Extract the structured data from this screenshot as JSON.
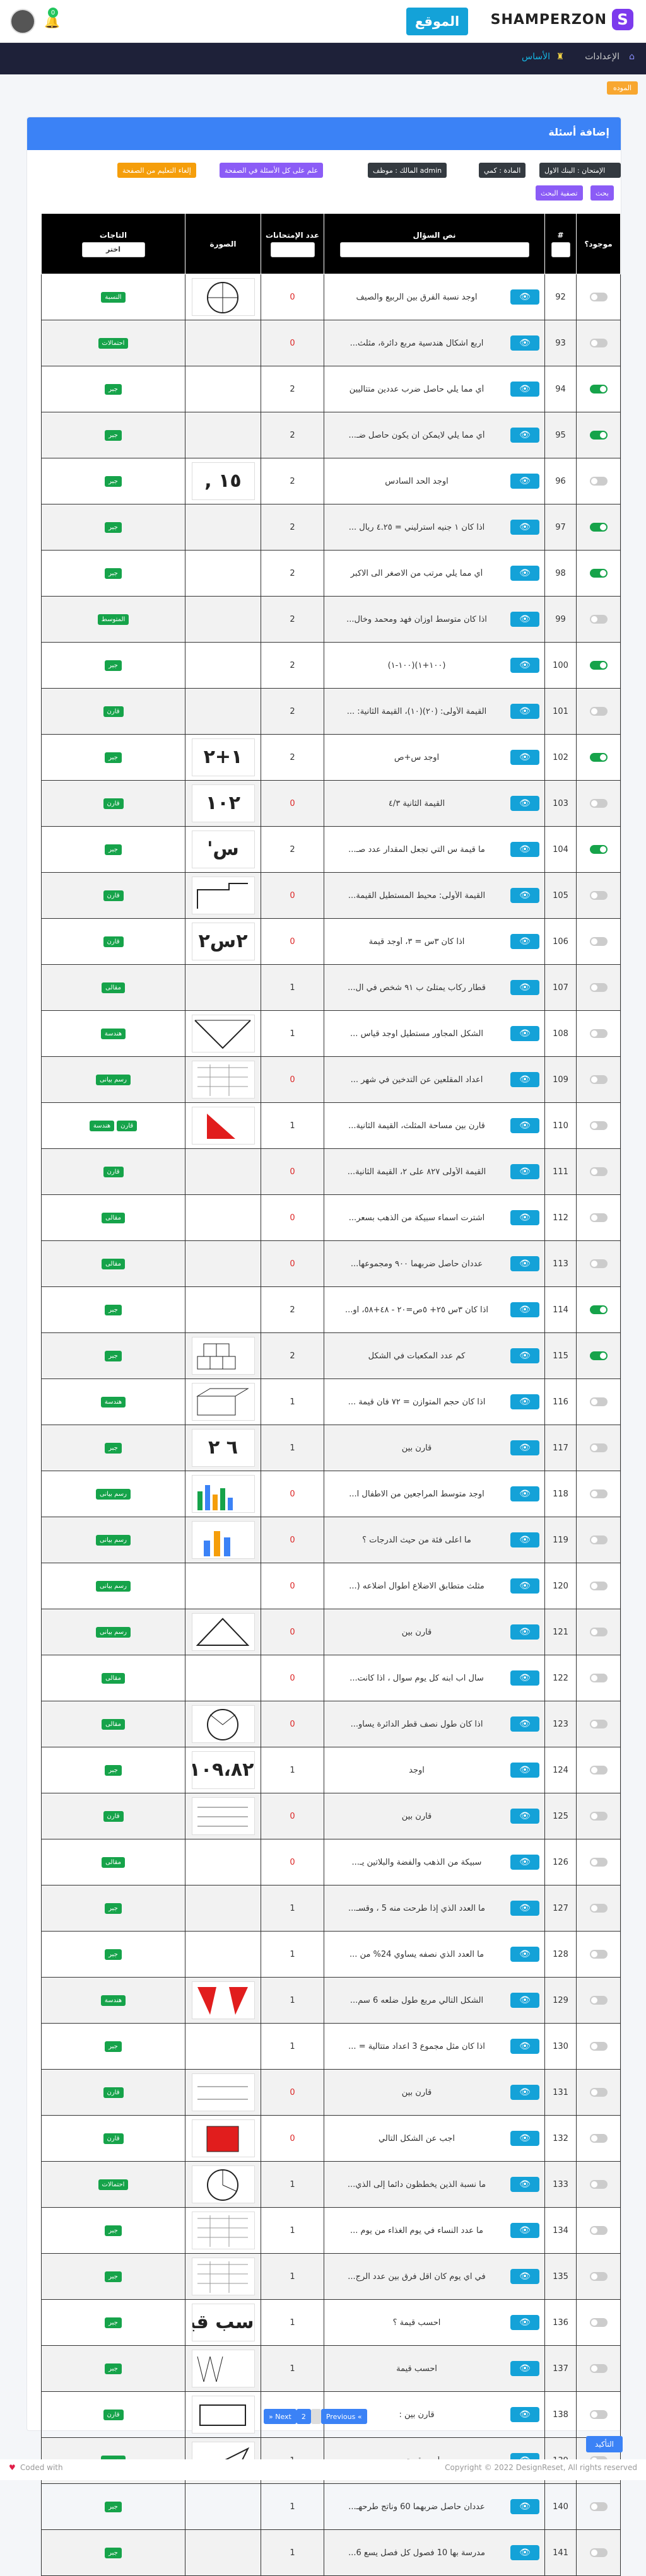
{
  "header": {
    "brand": "SHAMPERZON",
    "brand_mark": "S",
    "site_button": "الموقع",
    "notif_count": "0"
  },
  "nav": {
    "settings": "الإعدادات",
    "basics": "الأساس"
  },
  "breadcrumb": "الموده",
  "card": {
    "title": "إضافة أسئلة"
  },
  "filters": {
    "exam": "الإمتحان : البنك الاول",
    "subject": "المادة : كمي",
    "owner": "المالك : موظف admin",
    "search": "بحث",
    "reset": "تصفية البحث",
    "mark_all": "علم على كل الأسئلة في الصفحة",
    "unmark_all": "إلغاء التعليم من الصفحة"
  },
  "table": {
    "headers": {
      "exists": "موجود؟",
      "num": "#",
      "text": "نص السؤال",
      "exams": "عدد الإمتحانات",
      "image": "الصورة",
      "tags": "التاجات"
    },
    "tag_select": "اختر",
    "rows": [
      {
        "n": "92",
        "q": "اوجد نسبة الفرق بين الربيع والصيف",
        "c": "0",
        "img": "circle",
        "tags": [
          "النسبة"
        ],
        "on": false
      },
      {
        "n": "93",
        "q": "اربع اشكال هندسية مربع دائرة، مثلث...",
        "c": "0",
        "img": "",
        "tags": [
          "احتمالات"
        ],
        "on": false
      },
      {
        "n": "94",
        "q": "أي مما يلي حاصل ضرب عددين متتاليين",
        "c": "2",
        "img": "",
        "tags": [
          "جبر"
        ],
        "on": true
      },
      {
        "n": "95",
        "q": "أي مما يلي لايمكن ان يكون حاصل ضـ...",
        "c": "2",
        "img": "",
        "tags": [
          "جبر"
        ],
        "on": true
      },
      {
        "n": "96",
        "q": "اوجد الحد السادس",
        "c": "2",
        "img": "١٥ ,",
        "tags": [
          "جبر"
        ],
        "on": false
      },
      {
        "n": "97",
        "q": "اذا كان ١ جنيه استرليني = ٤.٢٥ ريال ...",
        "c": "2",
        "img": "",
        "tags": [
          "جبر"
        ],
        "on": true
      },
      {
        "n": "98",
        "q": "أي مما يلي مرتب من الاصغر الى الاكبر",
        "c": "2",
        "img": "",
        "tags": [
          "جبر"
        ],
        "on": true
      },
      {
        "n": "99",
        "q": "اذا كان متوسط اوزان فهد ومحمد وخال...",
        "c": "2",
        "img": "",
        "tags": [
          "المتوسط"
        ],
        "on": false
      },
      {
        "n": "100",
        "q": "(١٠٠+١)(١٠٠-١)",
        "c": "2",
        "img": "",
        "tags": [
          "جبر"
        ],
        "on": true
      },
      {
        "n": "101",
        "q": "القيمة الأولى: (٢٠)(١٠)، القيمة الثانية: ...",
        "c": "2",
        "img": "",
        "tags": [
          "قارن"
        ],
        "on": false
      },
      {
        "n": "102",
        "q": "اوجد س+ص",
        "c": "2",
        "img": "١+٢",
        "tags": [
          "جبر"
        ],
        "on": true
      },
      {
        "n": "103",
        "q": "القيمة الثانية ٤/٣",
        "c": "0",
        "img": "١٠٢",
        "tags": [
          "قارن"
        ],
        "on": false
      },
      {
        "n": "104",
        "q": "ما قيمة س التي تجعل المقدار عدد صـ...",
        "c": "2",
        "img": "س'",
        "tags": [
          "جبر"
        ],
        "on": true
      },
      {
        "n": "105",
        "q": "القيمة الأولى: محيط المستطيل القيمة...",
        "c": "0",
        "img": "line",
        "tags": [
          "قارن"
        ],
        "on": false
      },
      {
        "n": "106",
        "q": "اذا كان ٣س = ٣، أوجد قيمة",
        "c": "0",
        "img": "٢س٢",
        "tags": [
          "قارن"
        ],
        "on": false
      },
      {
        "n": "107",
        "q": "قطار ركاب يمتلئ ب ٩١ شخص في ال...",
        "c": "1",
        "img": "",
        "tags": [
          "مقالى"
        ],
        "on": false
      },
      {
        "n": "108",
        "q": "الشكل المجاور مستطيل اوجد قياس ...",
        "c": "1",
        "img": "tri",
        "tags": [
          "هندسة"
        ],
        "on": false
      },
      {
        "n": "109",
        "q": "اعداد المقلعين عن التدخين في شهر ...",
        "c": "0",
        "img": "grid",
        "tags": [
          "رسم بيانى"
        ],
        "on": false
      },
      {
        "n": "110",
        "q": "قارن بين مساحة المثلث، القيمة الثانية...",
        "c": "1",
        "img": "redtri",
        "tags": [
          "قارن",
          "هندسة"
        ],
        "on": false
      },
      {
        "n": "111",
        "q": "القيمة الأولى ٨٢٧ على ٢، القيمة الثانية...",
        "c": "0",
        "img": "",
        "tags": [
          "قارن"
        ],
        "on": false
      },
      {
        "n": "112",
        "q": "اشترت اسماء سبيكة من الذهب بسعر...",
        "c": "0",
        "img": "",
        "tags": [
          "مقالى"
        ],
        "on": false
      },
      {
        "n": "113",
        "q": "عددان حاصل ضربهما ٩٠٠ ومجموعها...",
        "c": "0",
        "img": "",
        "tags": [
          "مقالى"
        ],
        "on": false
      },
      {
        "n": "114",
        "q": "اذا كان ٣س ٢٥+ ٥ص=٢٠ - ٤٨+٥٨، او...",
        "c": "2",
        "img": "",
        "tags": [
          "جبر"
        ],
        "on": true
      },
      {
        "n": "115",
        "q": "كم عدد المكعبات في الشكل",
        "c": "2",
        "img": "cube",
        "tags": [
          "جبر"
        ],
        "on": true
      },
      {
        "n": "116",
        "q": "اذا كان حجم المتوازن = ٧٢ فان قيمة ...",
        "c": "1",
        "img": "box",
        "tags": [
          "هندسة"
        ],
        "on": false
      },
      {
        "n": "117",
        "q": "قارن بين",
        "c": "1",
        "img": "٦ ٢",
        "tags": [
          "جبر"
        ],
        "on": false
      },
      {
        "n": "118",
        "q": "اوجد متوسط المراجعين من الاطفال ا...",
        "c": "0",
        "img": "bars",
        "tags": [
          "رسم بيانى"
        ],
        "on": false
      },
      {
        "n": "119",
        "q": "ما اعلى فئة من حيث الدرجات ؟",
        "c": "0",
        "img": "bars2",
        "tags": [
          "رسم بيانى"
        ],
        "on": false
      },
      {
        "n": "120",
        "q": "مثلث متطابق الاضلاع أطوال أضلاعه (...",
        "c": "0",
        "img": "",
        "tags": [
          "رسم بيانى"
        ],
        "on": false
      },
      {
        "n": "121",
        "q": "قارن بين",
        "c": "0",
        "img": "tri2",
        "tags": [
          "رسم بيانى"
        ],
        "on": false
      },
      {
        "n": "122",
        "q": "سال اب ابنه كل يوم سوال ، اذا كانت...",
        "c": "0",
        "img": "",
        "tags": [
          "مقالى"
        ],
        "on": false
      },
      {
        "n": "123",
        "q": "اذا كان طول نصف قطر الدائرة يساو...",
        "c": "0",
        "img": "circle2",
        "tags": [
          "مقالى"
        ],
        "on": false
      },
      {
        "n": "124",
        "q": "اوجد",
        "c": "1",
        "img": "١٠٩،٨٢ فرا",
        "tags": [
          "جبر"
        ],
        "on": false
      },
      {
        "n": "125",
        "q": "قارن بين",
        "c": "0",
        "img": "text",
        "tags": [
          "قارن"
        ],
        "on": false
      },
      {
        "n": "126",
        "q": "سبيكة من الذهب والفضة والبلاتين يـ...",
        "c": "0",
        "img": "",
        "tags": [
          "مقالى"
        ],
        "on": false
      },
      {
        "n": "127",
        "q": "ما العدد الذي إذا طرحت منه 5 ، وقسـ...",
        "c": "1",
        "img": "",
        "tags": [
          "جبر"
        ],
        "on": false
      },
      {
        "n": "128",
        "q": "ما العدد الذي نصفه يساوي 24% من ...",
        "c": "1",
        "img": "",
        "tags": [
          "جبر"
        ],
        "on": false
      },
      {
        "n": "129",
        "q": "الشكل التالي مربع طول ضلعه 6 سم...",
        "c": "1",
        "img": "redflag",
        "tags": [
          "هندسة"
        ],
        "on": false
      },
      {
        "n": "130",
        "q": "اذا كان مثل مجموع 3 اعداد متتالية = ...",
        "c": "1",
        "img": "",
        "tags": [
          "جبر"
        ],
        "on": false
      },
      {
        "n": "131",
        "q": "قارن بين",
        "c": "0",
        "img": "text2",
        "tags": [
          "قارن"
        ],
        "on": false
      },
      {
        "n": "132",
        "q": "اجب عن الشكل التالي",
        "c": "0",
        "img": "redsq",
        "tags": [
          "قارن"
        ],
        "on": false
      },
      {
        "n": "133",
        "q": "ما نسبة الذين يخطظون دائما إلى الذي...",
        "c": "1",
        "img": "pie",
        "tags": [
          "احتمالات"
        ],
        "on": false
      },
      {
        "n": "134",
        "q": "ما عدد النساء في يوم الغذاء من يوم ...",
        "c": "1",
        "img": "grid",
        "tags": [
          "جبر"
        ],
        "on": false
      },
      {
        "n": "135",
        "q": "في اي يوم كان اقل فرق بين عدد الرج...",
        "c": "1",
        "img": "grid",
        "tags": [
          "جبر"
        ],
        "on": false
      },
      {
        "n": "136",
        "q": "احسب قيمة ؟",
        "c": "1",
        "img": "سب قيمة",
        "tags": [
          "جبر"
        ],
        "on": false
      },
      {
        "n": "137",
        "q": "احسب قيمة",
        "c": "1",
        "img": "bars3",
        "tags": [
          "جبر"
        ],
        "on": false
      },
      {
        "n": "138",
        "q": "قارن بين :",
        "c": "0",
        "img": "line2",
        "tags": [
          "قارن"
        ],
        "on": false
      },
      {
        "n": "139",
        "q": "أوجد قيمة س",
        "c": "1",
        "img": "tri3",
        "tags": [
          "هندسة"
        ],
        "on": false
      },
      {
        "n": "140",
        "q": "عددان حاصل ضربهما 60 وناتج طرحهـ...",
        "c": "1",
        "img": "",
        "tags": [
          "جبر"
        ],
        "on": false
      },
      {
        "n": "141",
        "q": "مدرسة بها 10 فصول كل فصل يسع 6...",
        "c": "1",
        "img": "",
        "tags": [
          "جبر"
        ],
        "on": false
      }
    ]
  },
  "pagination": {
    "prev": "Previous «",
    "page": "2",
    "next": "» Next"
  },
  "confirm": "التأكيد",
  "footer": {
    "left": "Coded with",
    "right": "Copyright © 2022 DesignReset, All rights reserved"
  }
}
